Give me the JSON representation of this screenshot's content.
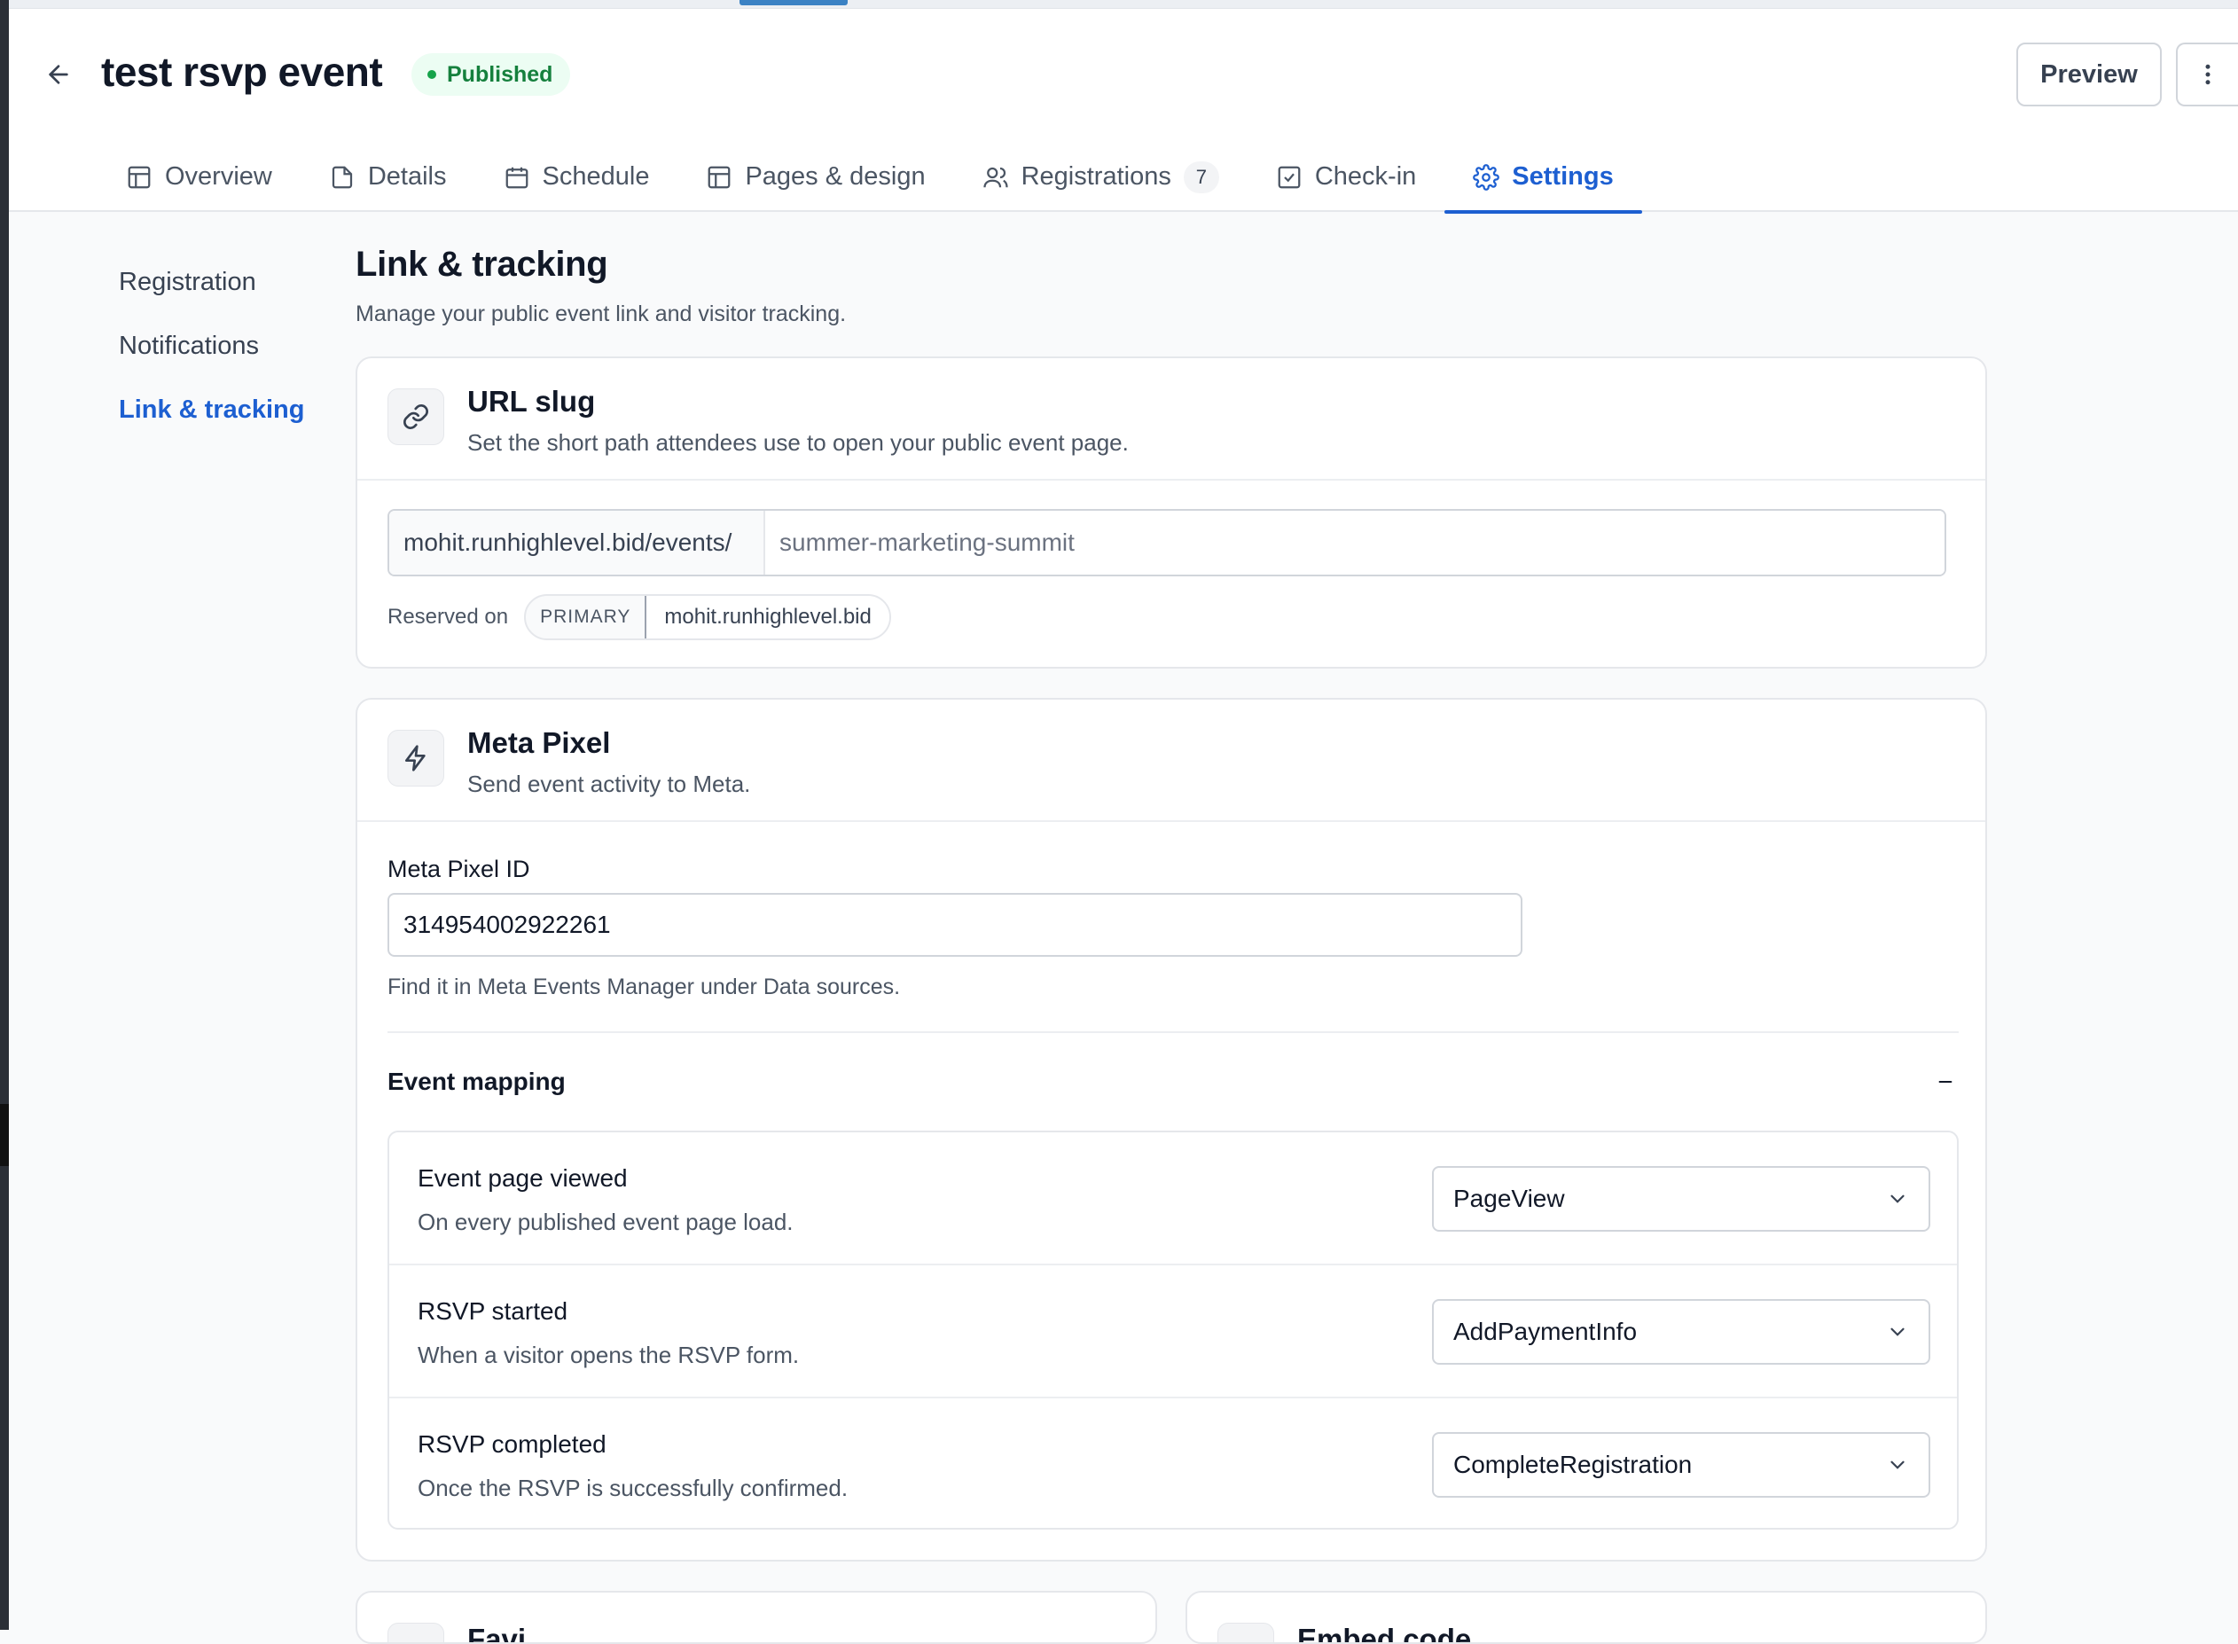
{
  "header": {
    "title": "test rsvp event",
    "status": "Published",
    "preview_label": "Preview"
  },
  "tabs": [
    {
      "label": "Overview",
      "icon": "layout-icon"
    },
    {
      "label": "Details",
      "icon": "document-icon"
    },
    {
      "label": "Schedule",
      "icon": "calendar-icon"
    },
    {
      "label": "Pages & design",
      "icon": "layout-icon"
    },
    {
      "label": "Registrations",
      "icon": "users-icon",
      "count": "7"
    },
    {
      "label": "Check-in",
      "icon": "check-square-icon"
    },
    {
      "label": "Settings",
      "icon": "gear-icon",
      "active": true
    }
  ],
  "sidenav": {
    "items": [
      {
        "label": "Registration"
      },
      {
        "label": "Notifications"
      },
      {
        "label": "Link & tracking",
        "active": true
      }
    ]
  },
  "section": {
    "title": "Link & tracking",
    "subtitle": "Manage your public event link and visitor tracking."
  },
  "url_slug": {
    "title": "URL slug",
    "description": "Set the short path attendees use to open your public event page.",
    "prefix": "mohit.runhighlevel.bid/events/",
    "placeholder": "summer-marketing-summit",
    "value": "",
    "reserved_label": "Reserved on",
    "domain_tag": "PRIMARY",
    "domain": "mohit.runhighlevel.bid"
  },
  "meta_pixel": {
    "title": "Meta Pixel",
    "description": "Send event activity to Meta.",
    "id_label": "Meta Pixel ID",
    "id_value": "314954002922261",
    "help": "Find it in Meta Events Manager under Data sources.",
    "mapping_title": "Event mapping",
    "mappings": [
      {
        "name": "Event page viewed",
        "description": "On every published event page load.",
        "value": "PageView"
      },
      {
        "name": "RSVP started",
        "description": "When a visitor opens the RSVP form.",
        "value": "AddPaymentInfo"
      },
      {
        "name": "RSVP completed",
        "description": "Once the RSVP is successfully confirmed.",
        "value": "CompleteRegistration"
      }
    ]
  },
  "lower_cards": [
    {
      "title": "Favi"
    },
    {
      "title": "Embed code"
    }
  ],
  "colors": {
    "accent": "#1d5fd1",
    "published_bg": "#ecfdf3",
    "published_text": "#15803d"
  }
}
